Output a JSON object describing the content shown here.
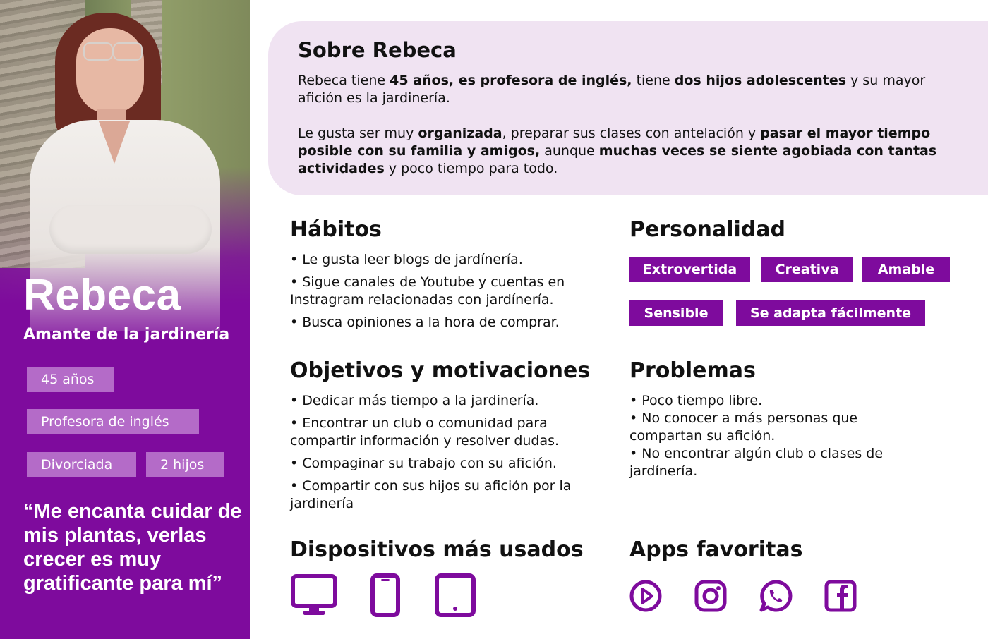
{
  "profile": {
    "name": "Rebeca",
    "role": "Amante de la jardinería",
    "tags": [
      "45 años",
      "Profesora de inglés",
      "Divorciada",
      "2 hijos"
    ],
    "quote": "“Me encanta cuidar de mis plantas, verlas crecer es muy gratificante para mí”"
  },
  "about": {
    "title": "Sobre Rebeca",
    "p1": {
      "t1": "Rebeca tiene ",
      "b1": "45 años, es profesora de inglés,",
      "t2": " tiene ",
      "b2": "dos hijos adolescentes",
      "t3": " y su mayor afición es la jardinería."
    },
    "p2": {
      "t1": "Le gusta ser muy ",
      "b1": "organizada",
      "t2": ", preparar sus clases con antelación y ",
      "b2": "pasar el mayor tiempo posible con su familia y amigos,",
      "t3": " aunque ",
      "b3": "muchas veces se siente agobiada con tantas actividades",
      "t4": " y poco tiempo para todo."
    }
  },
  "habits": {
    "title": "Hábitos",
    "items": [
      "• Le gusta leer blogs de jardínería.",
      "• Sigue canales de Youtube y cuentas en Instragram relacionadas con jardínería.",
      "• Busca opiniones a la hora de comprar."
    ]
  },
  "personality": {
    "title": "Personalidad",
    "tags": [
      "Extrovertida",
      "Creativa",
      "Amable",
      "Sensible",
      "Se adapta fácilmente"
    ]
  },
  "goals": {
    "title": "Objetivos y motivaciones",
    "items": [
      "• Dedicar más tiempo a la jardinería.",
      "• Encontrar un club o comunidad para compartir información y resolver dudas.",
      "• Compaginar su trabajo con su afición.",
      "• Compartir con sus hijos su afición por la jardinería"
    ]
  },
  "problems": {
    "title": "Problemas",
    "items": [
      "• Poco tiempo libre.",
      "• No conocer a más personas que compartan su afición.",
      "• No encontrar algún club o clases de jardínería."
    ]
  },
  "devices": {
    "title": "Dispositivos más usados",
    "icons": [
      "desktop-icon",
      "smartphone-icon",
      "tablet-icon"
    ]
  },
  "apps": {
    "title": "Apps favoritas",
    "icons": [
      "youtube-icon",
      "instagram-icon",
      "whatsapp-icon",
      "facebook-icon"
    ]
  },
  "colors": {
    "accent": "#7e0b9d",
    "tag_light": "#b46bc8",
    "card_bg": "#f0e3f2"
  }
}
